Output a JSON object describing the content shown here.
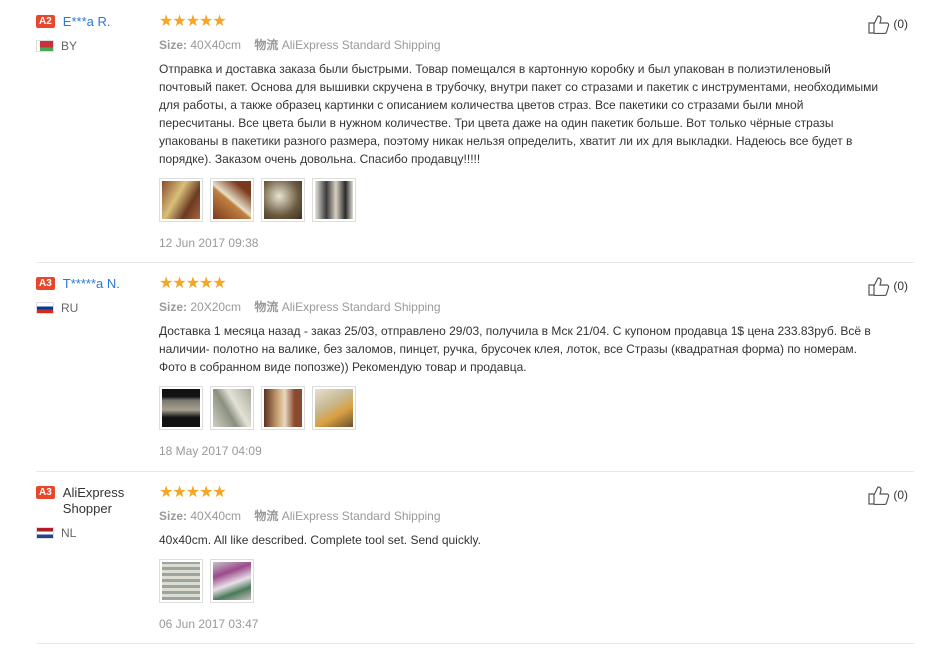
{
  "reviews": [
    {
      "level": "A2",
      "name": "E***a R.",
      "country": "BY",
      "size_label": "Size:",
      "size": "40X40cm",
      "shipping_label": "物流",
      "shipping": "AliExpress Standard Shipping",
      "text": "Отправка и доставка заказа были быстрыми. Товар помещался в картонную коробку и был упакован в полиэтиленовый почтовый пакет. Основа для вышивки скручена в трубочку, внутри пакет со стразами и пакетик с инструментами, необходимыми для работы, а также образец картинки с описанием количества цветов страз. Все пакетики со стразами были мной пересчитаны. Все цвета были в нужном количестве. Три цвета даже на один пакетик больше. Вот только чёрные стразы упакованы в пакетики разного размера, поэтому никак нельзя определить, хватит ли их для выкладки. Надеюсь все будет в порядке). Заказом очень довольна. Спасибо продавцу!!!!!",
      "date": "12 Jun 2017 09:38",
      "helpful": "(0)",
      "stars": "★★★★★"
    },
    {
      "level": "A3",
      "name": "T*****a N.",
      "country": "RU",
      "size_label": "Size:",
      "size": "20X20cm",
      "shipping_label": "物流",
      "shipping": "AliExpress Standard Shipping",
      "text": "Доставка 1 месяца назад - заказ 25/03, отправлено 29/03, получила в Мск 21/04. С купоном продавца 1$ цена 233.83руб. Всё в наличии- полотно на валике, без заломов, пинцет, ручка, брусочек клея, лоток, все Стразы (квадратная форма) по номерам. Фото в собранном виде попозже)) Рекомендую товар и продавца.",
      "date": "18 May 2017 04:09",
      "helpful": "(0)",
      "stars": "★★★★★"
    },
    {
      "level": "A3",
      "name": "AliExpress Shopper",
      "country": "NL",
      "size_label": "Size:",
      "size": "40X40cm",
      "shipping_label": "物流",
      "shipping": "AliExpress Standard Shipping",
      "text": "40x40cm. All like described. Complete tool set. Send quickly.",
      "date": "06 Jun 2017 03:47",
      "helpful": "(0)",
      "stars": "★★★★★"
    }
  ],
  "colors": {
    "accent": "#f5a623",
    "link": "#2a7ad5",
    "badge": "#e8472b"
  }
}
